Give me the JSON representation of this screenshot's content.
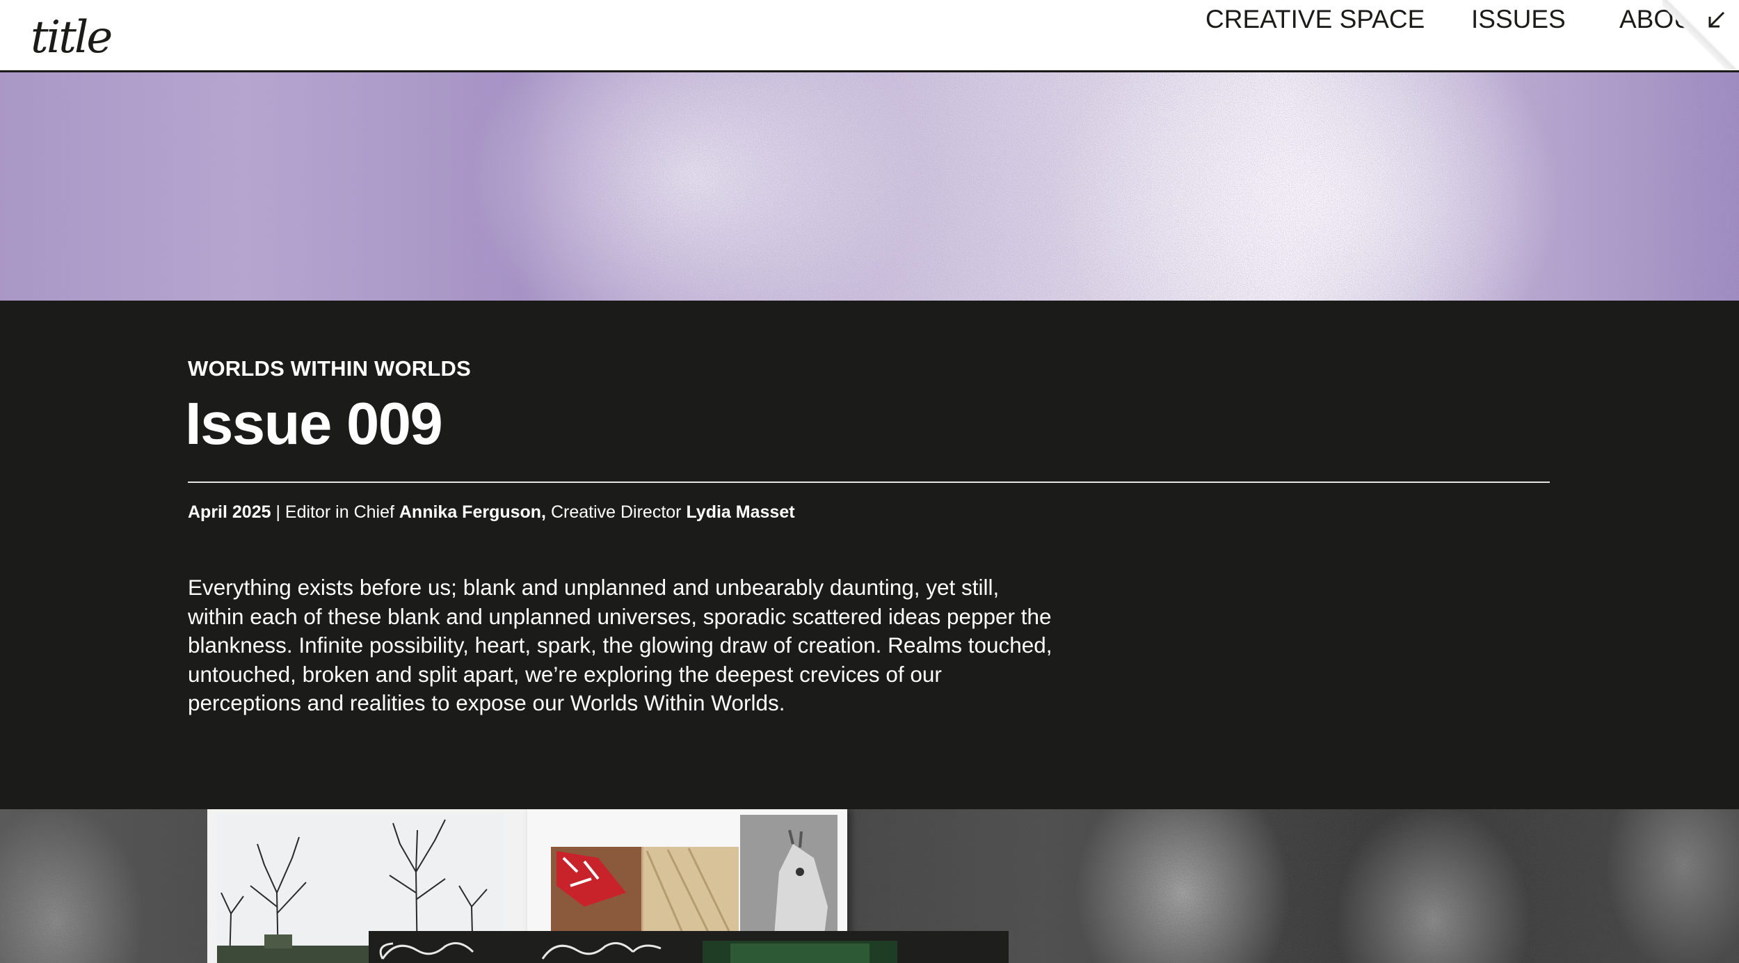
{
  "header": {
    "logo_text": "title",
    "nav": [
      {
        "label": "CREATIVE SPACE"
      },
      {
        "label": "ISSUES"
      },
      {
        "label": "ABOUT"
      }
    ],
    "corner_icon": "arrow-down-left-icon"
  },
  "issue": {
    "kicker": "WORLDS WITHIN WORLDS",
    "title": "Issue 009",
    "date": "April 2025",
    "separator": " | ",
    "editor_role": "Editor in Chief ",
    "editor_name": "Annika Ferguson,",
    "director_role": " Creative Director ",
    "director_name": "Lydia Masset",
    "description": "Everything exists before us; blank and unplanned and unbearably daunting, yet still, within each of these blank and unplanned universes, sporadic scattered ideas pepper the blankness. Infinite possibility, heart, spark, the glowing draw of creation. Realms touched, untouched, broken and split apart, we’re exploring the deepest crevices of our perceptions and realities to expose our Worlds Within Worlds."
  },
  "colors": {
    "background_dark": "#1b1b19",
    "header_bg": "#ffffff",
    "text_light": "#ffffff",
    "accent_purple": "#a996c6"
  }
}
